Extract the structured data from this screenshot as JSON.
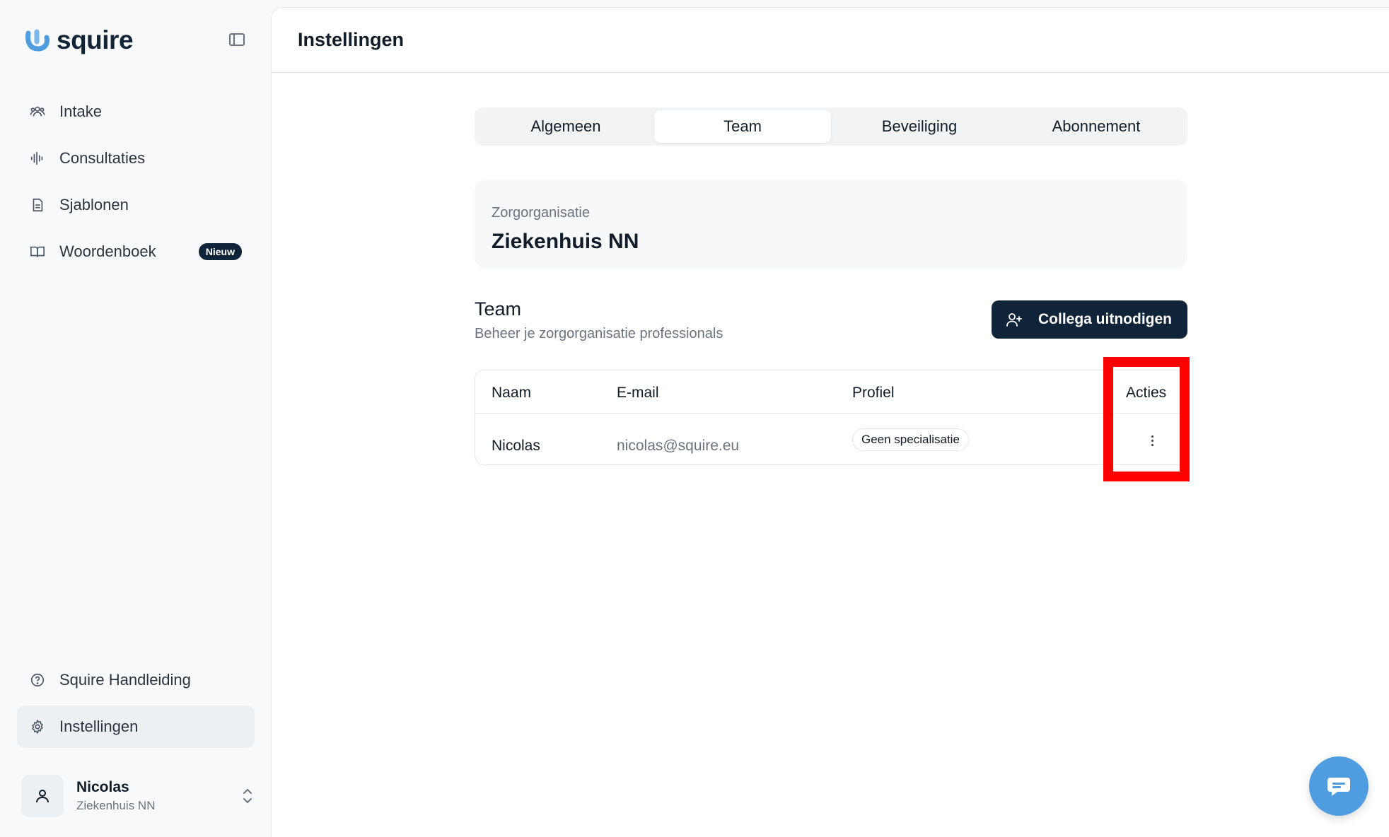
{
  "brand": {
    "name": "squire"
  },
  "sidebar": {
    "items": [
      {
        "label": "Intake",
        "icon": "users-icon"
      },
      {
        "label": "Consultaties",
        "icon": "audio-waveform-icon"
      },
      {
        "label": "Sjablonen",
        "icon": "document-icon"
      },
      {
        "label": "Woordenboek",
        "icon": "book-open-icon",
        "badge": "Nieuw"
      }
    ],
    "bottom_items": [
      {
        "label": "Squire Handleiding",
        "icon": "help-circle-icon"
      },
      {
        "label": "Instellingen",
        "icon": "gear-icon",
        "active": true
      }
    ],
    "user": {
      "name": "Nicolas",
      "organization": "Ziekenhuis NN"
    }
  },
  "header": {
    "title": "Instellingen"
  },
  "tabs": [
    {
      "label": "Algemeen"
    },
    {
      "label": "Team",
      "active": true
    },
    {
      "label": "Beveiliging"
    },
    {
      "label": "Abonnement"
    }
  ],
  "organization": {
    "label": "Zorgorganisatie",
    "name": "Ziekenhuis NN"
  },
  "team": {
    "title": "Team",
    "subtitle": "Beheer je zorgorganisatie professionals",
    "invite_label": "Collega uitnodigen",
    "columns": [
      "Naam",
      "E-mail",
      "Profiel",
      "Acties"
    ],
    "rows": [
      {
        "name": "Nicolas",
        "email": "nicolas@squire.eu",
        "profile": "Geen specialisatie"
      }
    ]
  },
  "colors": {
    "accent_dark": "#0f2438",
    "highlight": "#ff0000",
    "chat": "#4f9ce0"
  }
}
